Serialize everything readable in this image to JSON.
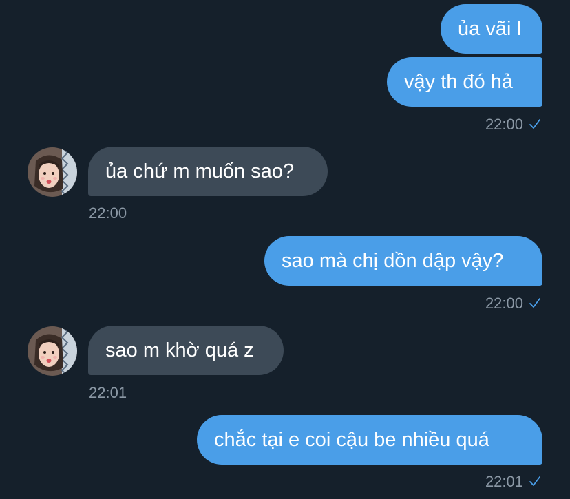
{
  "colors": {
    "background": "#15202b",
    "outgoing_bubble": "#4a9ee8",
    "incoming_bubble": "#3d4a57",
    "timestamp": "#8b98a5",
    "check": "#4a9ee8"
  },
  "messages": [
    {
      "direction": "outgoing",
      "text": "ủa vãi l"
    },
    {
      "direction": "outgoing",
      "text": "vậy th đó hả",
      "time": "22:00",
      "read_icon": "check-icon"
    },
    {
      "direction": "incoming",
      "text": "ủa chứ m muốn sao?",
      "time": "22:00",
      "avatar_icon": "avatar-photo"
    },
    {
      "direction": "outgoing",
      "text": "sao mà chị dồn dập vậy?",
      "time": "22:00",
      "read_icon": "check-icon"
    },
    {
      "direction": "incoming",
      "text": "sao m khờ quá z",
      "time": "22:01",
      "avatar_icon": "avatar-photo"
    },
    {
      "direction": "outgoing",
      "text": "chắc tại e coi cậu be nhiều quá",
      "time": "22:01",
      "read_icon": "check-icon"
    }
  ]
}
